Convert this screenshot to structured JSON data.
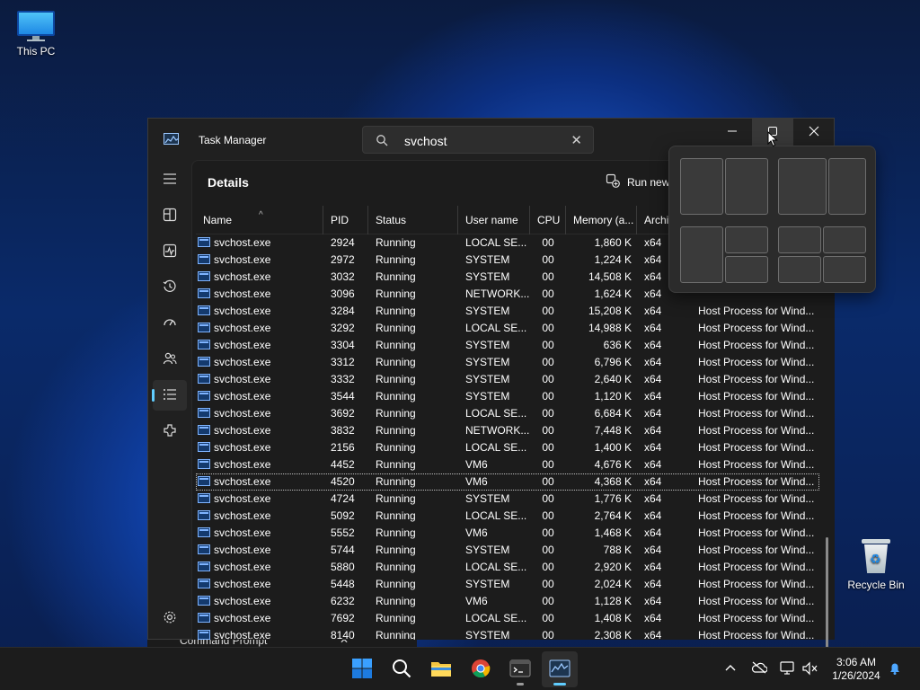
{
  "desktop": {
    "this_pc_label": "This PC",
    "recycle_bin_label": "Recycle Bin"
  },
  "window": {
    "title": "Task Manager",
    "search_value": "svchost",
    "page_title": "Details",
    "run_new_label": "Run new",
    "icons": [
      "app-icon",
      "search-icon",
      "close-icon",
      "minimize-icon",
      "maximize-icon",
      "hamburger-icon",
      "processes-icon",
      "performance-icon",
      "app-history-icon",
      "startup-apps-icon",
      "users-icon",
      "details-icon",
      "services-icon",
      "settings-icon"
    ]
  },
  "table": {
    "columns": [
      "Name",
      "PID",
      "Status",
      "User name",
      "CPU",
      "Memory (a...",
      "Archi"
    ],
    "rows": [
      {
        "name": "svchost.exe",
        "pid": "2924",
        "status": "Running",
        "user": "LOCAL SE...",
        "cpu": "00",
        "mem": "1,860 K",
        "arch": "x64",
        "desc": ""
      },
      {
        "name": "svchost.exe",
        "pid": "2972",
        "status": "Running",
        "user": "SYSTEM",
        "cpu": "00",
        "mem": "1,224 K",
        "arch": "x64",
        "desc": ""
      },
      {
        "name": "svchost.exe",
        "pid": "3032",
        "status": "Running",
        "user": "SYSTEM",
        "cpu": "00",
        "mem": "14,508 K",
        "arch": "x64",
        "desc": ""
      },
      {
        "name": "svchost.exe",
        "pid": "3096",
        "status": "Running",
        "user": "NETWORK...",
        "cpu": "00",
        "mem": "1,624 K",
        "arch": "x64",
        "desc": ""
      },
      {
        "name": "svchost.exe",
        "pid": "3284",
        "status": "Running",
        "user": "SYSTEM",
        "cpu": "00",
        "mem": "15,208 K",
        "arch": "x64",
        "desc": "Host Process for Wind..."
      },
      {
        "name": "svchost.exe",
        "pid": "3292",
        "status": "Running",
        "user": "LOCAL SE...",
        "cpu": "00",
        "mem": "14,988 K",
        "arch": "x64",
        "desc": "Host Process for Wind..."
      },
      {
        "name": "svchost.exe",
        "pid": "3304",
        "status": "Running",
        "user": "SYSTEM",
        "cpu": "00",
        "mem": "636 K",
        "arch": "x64",
        "desc": "Host Process for Wind..."
      },
      {
        "name": "svchost.exe",
        "pid": "3312",
        "status": "Running",
        "user": "SYSTEM",
        "cpu": "00",
        "mem": "6,796 K",
        "arch": "x64",
        "desc": "Host Process for Wind..."
      },
      {
        "name": "svchost.exe",
        "pid": "3332",
        "status": "Running",
        "user": "SYSTEM",
        "cpu": "00",
        "mem": "2,640 K",
        "arch": "x64",
        "desc": "Host Process for Wind..."
      },
      {
        "name": "svchost.exe",
        "pid": "3544",
        "status": "Running",
        "user": "SYSTEM",
        "cpu": "00",
        "mem": "1,120 K",
        "arch": "x64",
        "desc": "Host Process for Wind..."
      },
      {
        "name": "svchost.exe",
        "pid": "3692",
        "status": "Running",
        "user": "LOCAL SE...",
        "cpu": "00",
        "mem": "6,684 K",
        "arch": "x64",
        "desc": "Host Process for Wind..."
      },
      {
        "name": "svchost.exe",
        "pid": "3832",
        "status": "Running",
        "user": "NETWORK...",
        "cpu": "00",
        "mem": "7,448 K",
        "arch": "x64",
        "desc": "Host Process for Wind..."
      },
      {
        "name": "svchost.exe",
        "pid": "2156",
        "status": "Running",
        "user": "LOCAL SE...",
        "cpu": "00",
        "mem": "1,400 K",
        "arch": "x64",
        "desc": "Host Process for Wind..."
      },
      {
        "name": "svchost.exe",
        "pid": "4452",
        "status": "Running",
        "user": "VM6",
        "cpu": "00",
        "mem": "4,676 K",
        "arch": "x64",
        "desc": "Host Process for Wind..."
      },
      {
        "name": "svchost.exe",
        "pid": "4520",
        "status": "Running",
        "user": "VM6",
        "cpu": "00",
        "mem": "4,368 K",
        "arch": "x64",
        "desc": "Host Process for Wind...",
        "selected": true
      },
      {
        "name": "svchost.exe",
        "pid": "4724",
        "status": "Running",
        "user": "SYSTEM",
        "cpu": "00",
        "mem": "1,776 K",
        "arch": "x64",
        "desc": "Host Process for Wind..."
      },
      {
        "name": "svchost.exe",
        "pid": "5092",
        "status": "Running",
        "user": "LOCAL SE...",
        "cpu": "00",
        "mem": "2,764 K",
        "arch": "x64",
        "desc": "Host Process for Wind..."
      },
      {
        "name": "svchost.exe",
        "pid": "5552",
        "status": "Running",
        "user": "VM6",
        "cpu": "00",
        "mem": "1,468 K",
        "arch": "x64",
        "desc": "Host Process for Wind..."
      },
      {
        "name": "svchost.exe",
        "pid": "5744",
        "status": "Running",
        "user": "SYSTEM",
        "cpu": "00",
        "mem": "788 K",
        "arch": "x64",
        "desc": "Host Process for Wind..."
      },
      {
        "name": "svchost.exe",
        "pid": "5880",
        "status": "Running",
        "user": "LOCAL SE...",
        "cpu": "00",
        "mem": "2,920 K",
        "arch": "x64",
        "desc": "Host Process for Wind..."
      },
      {
        "name": "svchost.exe",
        "pid": "5448",
        "status": "Running",
        "user": "SYSTEM",
        "cpu": "00",
        "mem": "2,024 K",
        "arch": "x64",
        "desc": "Host Process for Wind..."
      },
      {
        "name": "svchost.exe",
        "pid": "6232",
        "status": "Running",
        "user": "VM6",
        "cpu": "00",
        "mem": "1,128 K",
        "arch": "x64",
        "desc": "Host Process for Wind..."
      },
      {
        "name": "svchost.exe",
        "pid": "7692",
        "status": "Running",
        "user": "LOCAL SE...",
        "cpu": "00",
        "mem": "1,408 K",
        "arch": "x64",
        "desc": "Host Process for Wind..."
      },
      {
        "name": "svchost.exe",
        "pid": "8140",
        "status": "Running",
        "user": "SYSTEM",
        "cpu": "00",
        "mem": "2,308 K",
        "arch": "x64",
        "desc": "Host Process for Wind..."
      }
    ]
  },
  "background_tab": {
    "label": "Command Prompt"
  },
  "taskbar": {
    "apps": [
      "start-icon",
      "search-icon",
      "file-explorer-icon",
      "chrome-icon",
      "terminal-icon",
      "task-manager-icon"
    ],
    "tray": [
      "chevron-up-icon",
      "onedrive-icon",
      "network-icon",
      "volume-muted-icon",
      "notifications-icon"
    ]
  },
  "clock": {
    "time": "3:06 AM",
    "date": "1/26/2024"
  },
  "colors": {
    "accent": "#60cdff",
    "window_bg": "#202020",
    "content_bg": "#1c1c1c",
    "taskbar_bg": "#1c1c1c"
  }
}
